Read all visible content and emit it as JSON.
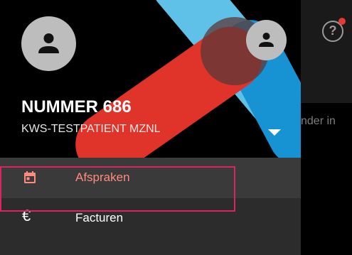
{
  "account": {
    "name": "NUMMER 686",
    "subtitle": "KWS-TESTPATIENT MZNL"
  },
  "menu": {
    "items": [
      {
        "label": "Afspraken",
        "icon": "calendar-icon",
        "active": true
      },
      {
        "label": "Facturen",
        "icon": "euro-icon",
        "active": false
      }
    ]
  },
  "euro_symbol": "€",
  "background_app": {
    "help_symbol": "?",
    "hint_text": "nder in"
  },
  "colors": {
    "header_background": "#000000",
    "drawer_background": "#2c2c2c",
    "active_item_text": "#ff8a80",
    "highlight_border": "#d8245f",
    "avatar": "#bdbdbd",
    "brand_red": "#e0332a",
    "brand_blue": "#1792d3",
    "brand_light_blue": "#5fc0e8"
  }
}
